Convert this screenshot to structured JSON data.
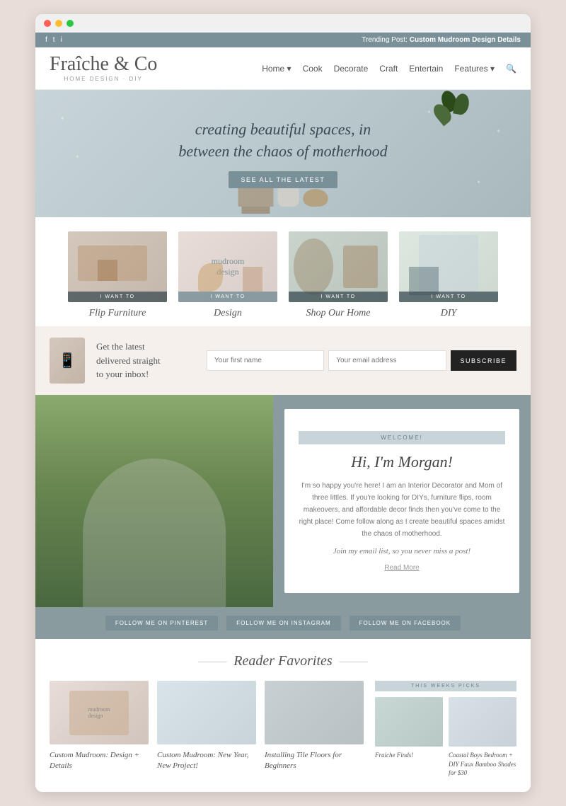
{
  "browser": {
    "dots": [
      "dot1",
      "dot2",
      "dot3"
    ]
  },
  "topbar": {
    "social": [
      "f",
      "t",
      "i"
    ],
    "trending_label": "Trending Post:",
    "trending_post": "Custom Mudroom Design Details"
  },
  "header": {
    "logo": "Fraîche & Co",
    "logo_sub": "HOME DESIGN · DIY",
    "nav": [
      {
        "label": "Home",
        "has_dropdown": true
      },
      {
        "label": "Cook"
      },
      {
        "label": "Decorate"
      },
      {
        "label": "Craft"
      },
      {
        "label": "Entertain"
      },
      {
        "label": "Features",
        "has_dropdown": true
      }
    ],
    "search_icon": "🔍"
  },
  "hero": {
    "title_line1": "creating beautiful spaces, in",
    "title_line2": "between the chaos of motherhood",
    "cta_button": "SEE ALL THE LATEST"
  },
  "categories": [
    {
      "label": "I WANT TO",
      "name": "Flip Furniture"
    },
    {
      "label": "I WANT TO",
      "name": "Design"
    },
    {
      "label": "I WANT TO",
      "name": "Shop Our Home"
    },
    {
      "label": "I WANT TO",
      "name": "DIY"
    }
  ],
  "newsletter": {
    "headline_line1": "Get the latest",
    "headline_line2": "delivered straight",
    "headline_line3": "to your inbox!",
    "first_name_placeholder": "Your first name",
    "email_placeholder": "Your email address",
    "button_label": "SUBSCRIBE"
  },
  "about": {
    "welcome_label": "WELCOME!",
    "title": "Hi, I'm Morgan!",
    "description": "I'm so happy you're here! I am an Interior Decorator and Mom of three littles. If you're looking for DIYs, furniture flips, room makeovers, and affordable decor finds then you've come to the right place! Come follow along as I create beautiful spaces amidst the chaos of motherhood.",
    "join_text": "Join my email list, so you never miss a post!",
    "read_more": "Read More",
    "social_buttons": [
      {
        "icon": "f",
        "label": "FOLLOW ME ON PINTEREST"
      },
      {
        "icon": "f",
        "label": "FOLLOW ME ON INSTAGRAM"
      },
      {
        "icon": "f",
        "label": "FOLLOW ME ON FACEBOOK"
      }
    ]
  },
  "reader_favorites": {
    "section_title": "Reader Favorites",
    "items": [
      {
        "title": "Custom Mudroom: Design + Details"
      },
      {
        "title": "Custom Mudroom: New Year, New Project!"
      },
      {
        "title": "Installing Tile Floors for Beginners"
      }
    ]
  },
  "this_weeks_picks": {
    "header": "THIS WEEKS PICKS",
    "items": [
      {
        "title": "Fraiche Finds!"
      },
      {
        "title": "Coastal Boys Bedroom + DIY Faux Bamboo Shades for $30"
      }
    ]
  }
}
